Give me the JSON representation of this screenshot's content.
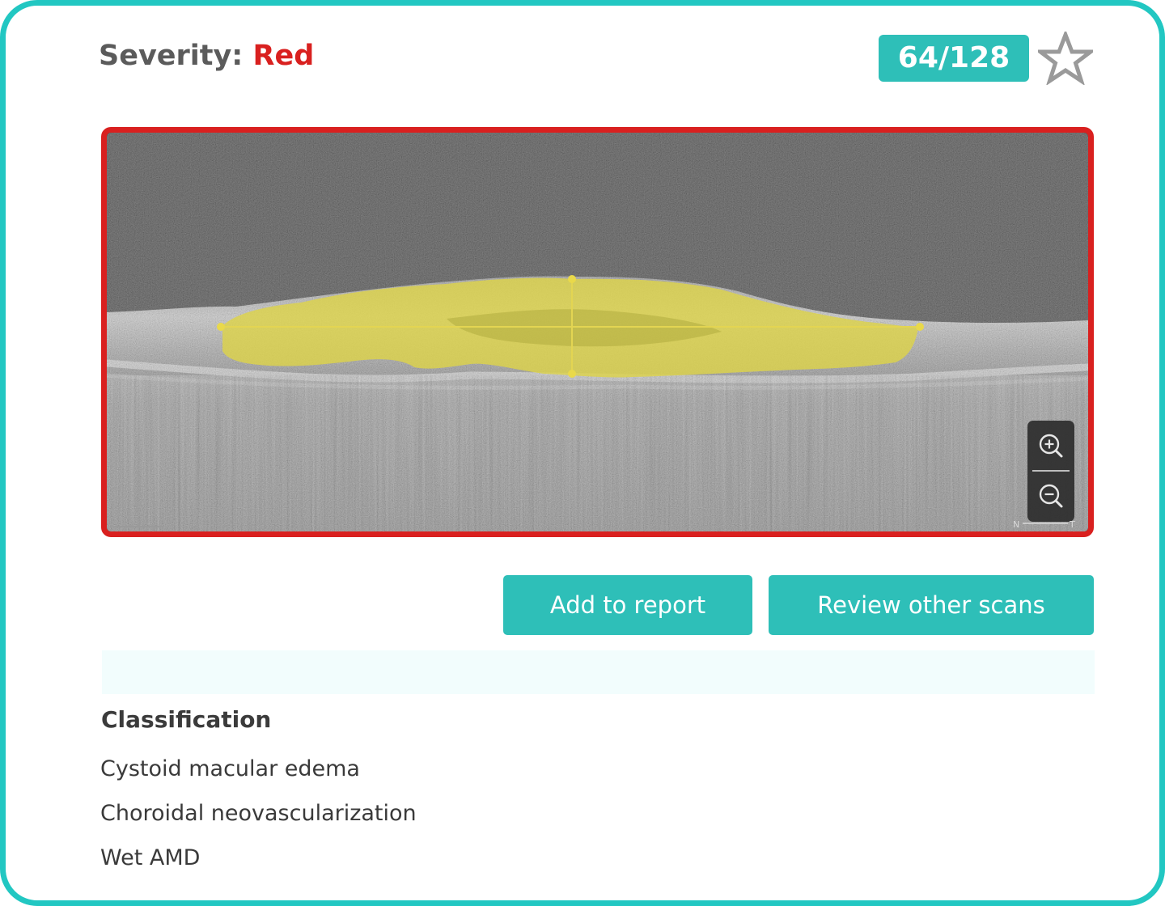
{
  "header": {
    "severity_label": "Severity:",
    "severity_value": "Red",
    "counter": "64/128"
  },
  "scan": {
    "zoom_in": "zoom-in",
    "zoom_out": "zoom-out",
    "orientation": "N T"
  },
  "actions": {
    "add_to_report": "Add to report",
    "review_other_scans": "Review other scans"
  },
  "classification": {
    "title": "Classification",
    "items": [
      "Cystoid macular edema",
      "Choroidal neovascularization",
      "Wet AMD"
    ]
  },
  "colors": {
    "accent": "#2ebfb8",
    "frame_border": "#22c7c2",
    "severity_red": "#d9201f",
    "lesion_overlay": "#ddd34a"
  },
  "icons": [
    "star-icon",
    "zoom-in-icon",
    "zoom-out-icon"
  ]
}
